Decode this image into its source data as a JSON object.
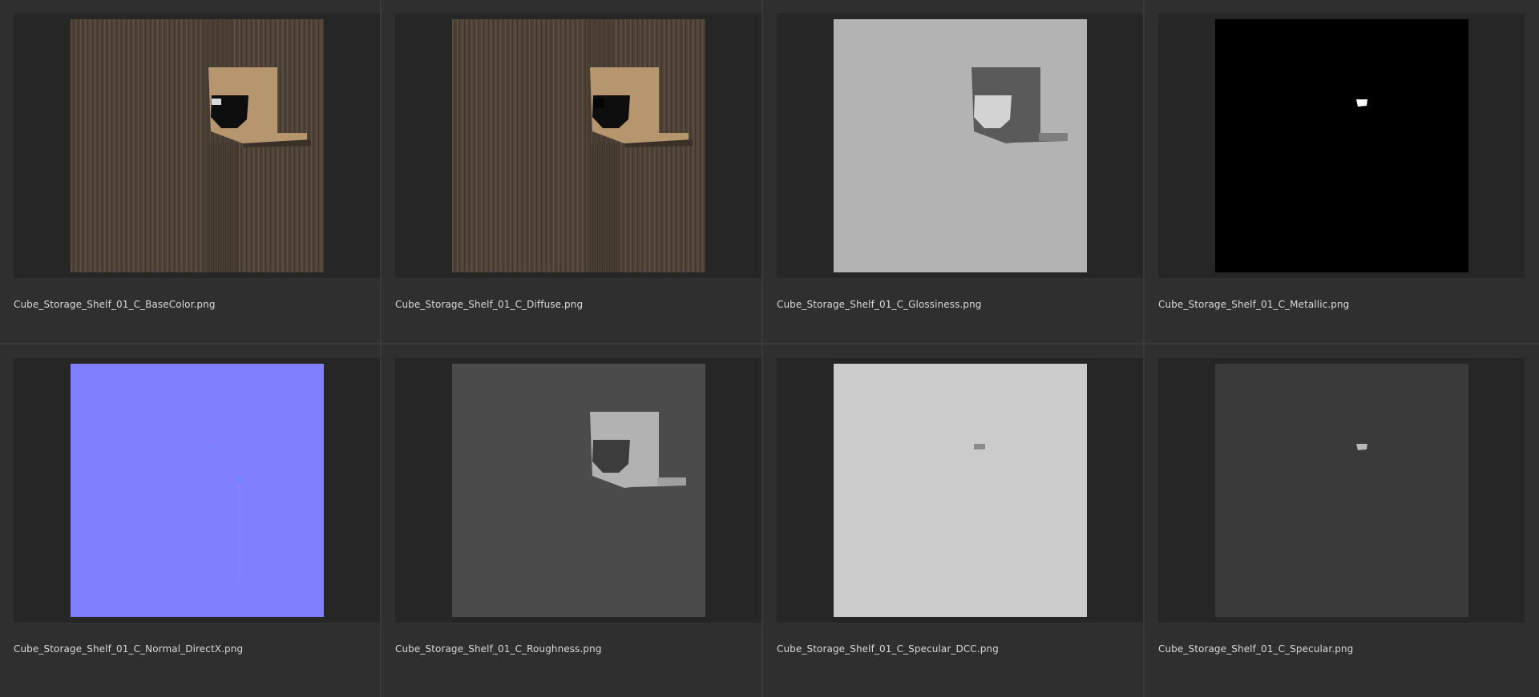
{
  "textures": [
    {
      "file": "Cube_Storage_Shelf_01_C_BaseColor.png",
      "map": "BaseColor",
      "base_color": "#4e4237"
    },
    {
      "file": "Cube_Storage_Shelf_01_C_Diffuse.png",
      "map": "Diffuse",
      "base_color": "#4e4237"
    },
    {
      "file": "Cube_Storage_Shelf_01_C_Glossiness.png",
      "map": "Glossiness",
      "base_color": "#b3b3b3"
    },
    {
      "file": "Cube_Storage_Shelf_01_C_Metallic.png",
      "map": "Metallic",
      "base_color": "#000000"
    },
    {
      "file": "Cube_Storage_Shelf_01_C_Normal_DirectX.png",
      "map": "Normal",
      "base_color": "#8080ff"
    },
    {
      "file": "Cube_Storage_Shelf_01_C_Roughness.png",
      "map": "Roughness",
      "base_color": "#4b4b4b"
    },
    {
      "file": "Cube_Storage_Shelf_01_C_Specular_DCC.png",
      "map": "Specular_DCC",
      "base_color": "#cbcbcb"
    },
    {
      "file": "Cube_Storage_Shelf_01_C_Specular.png",
      "map": "Specular",
      "base_color": "#3a3a3a"
    }
  ]
}
